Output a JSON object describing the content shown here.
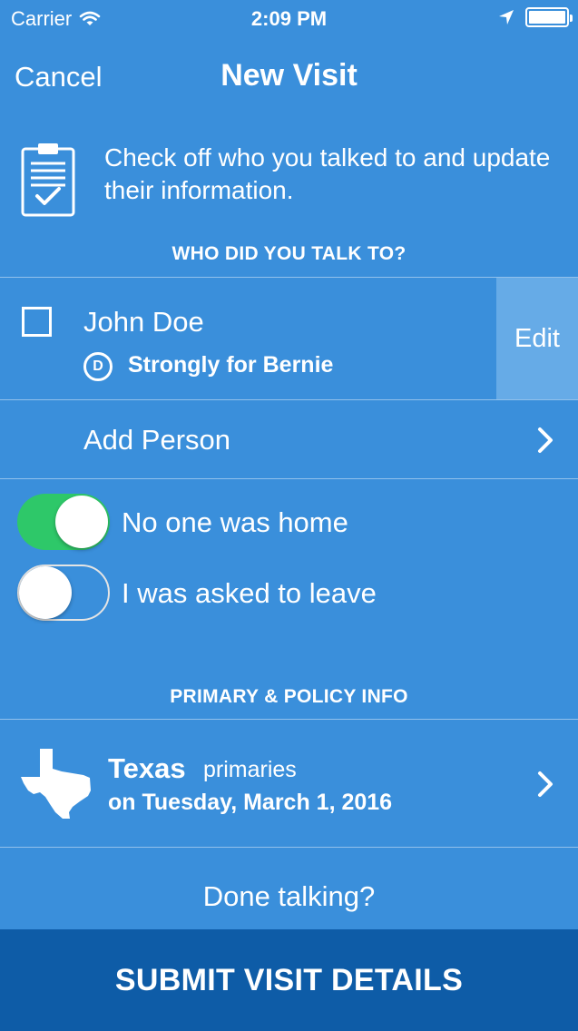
{
  "status_bar": {
    "carrier": "Carrier",
    "time": "2:09 PM",
    "icons": [
      "wifi-icon",
      "location-arrow-icon",
      "battery-icon"
    ]
  },
  "nav": {
    "cancel_label": "Cancel",
    "title": "New Visit"
  },
  "intro": {
    "icon": "clipboard-check-icon",
    "text": "Check off who you talked to and update their information."
  },
  "people_section": {
    "header": "WHO DID YOU TALK TO?",
    "people": [
      {
        "name": "John Doe",
        "party_badge": "D",
        "support": "Strongly for Bernie",
        "checked": false,
        "edit_label": "Edit"
      }
    ],
    "add_person_label": "Add Person"
  },
  "toggles": [
    {
      "label": "No one was home",
      "on": true
    },
    {
      "label": "I was asked to leave",
      "on": false
    }
  ],
  "primary_section": {
    "header": "PRIMARY & POLICY INFO",
    "state": "Texas",
    "type": "primaries",
    "date": "on Tuesday, March 1, 2016",
    "icon": "texas-map-icon"
  },
  "footer": {
    "done_text": "Done talking?",
    "submit_label": "SUBMIT VISIT DETAILS"
  },
  "colors": {
    "background": "#3a8fdb",
    "edit_button": "#66abe7",
    "toggle_on": "#2ec869",
    "submit_button": "#0e5ca7"
  }
}
